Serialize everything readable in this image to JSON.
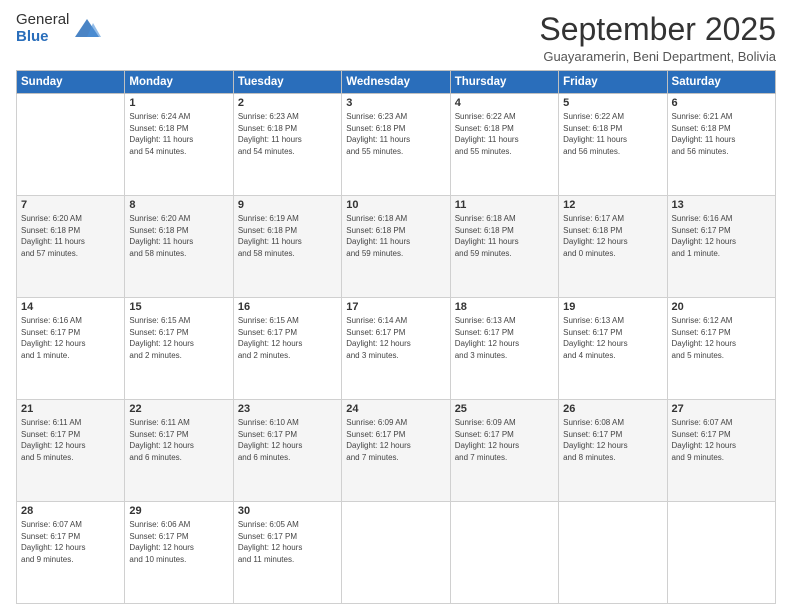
{
  "logo": {
    "general": "General",
    "blue": "Blue"
  },
  "header": {
    "month": "September 2025",
    "location": "Guayaramerin, Beni Department, Bolivia"
  },
  "weekdays": [
    "Sunday",
    "Monday",
    "Tuesday",
    "Wednesday",
    "Thursday",
    "Friday",
    "Saturday"
  ],
  "weeks": [
    [
      {
        "day": "",
        "info": ""
      },
      {
        "day": "1",
        "info": "Sunrise: 6:24 AM\nSunset: 6:18 PM\nDaylight: 11 hours\nand 54 minutes."
      },
      {
        "day": "2",
        "info": "Sunrise: 6:23 AM\nSunset: 6:18 PM\nDaylight: 11 hours\nand 54 minutes."
      },
      {
        "day": "3",
        "info": "Sunrise: 6:23 AM\nSunset: 6:18 PM\nDaylight: 11 hours\nand 55 minutes."
      },
      {
        "day": "4",
        "info": "Sunrise: 6:22 AM\nSunset: 6:18 PM\nDaylight: 11 hours\nand 55 minutes."
      },
      {
        "day": "5",
        "info": "Sunrise: 6:22 AM\nSunset: 6:18 PM\nDaylight: 11 hours\nand 56 minutes."
      },
      {
        "day": "6",
        "info": "Sunrise: 6:21 AM\nSunset: 6:18 PM\nDaylight: 11 hours\nand 56 minutes."
      }
    ],
    [
      {
        "day": "7",
        "info": "Sunrise: 6:20 AM\nSunset: 6:18 PM\nDaylight: 11 hours\nand 57 minutes."
      },
      {
        "day": "8",
        "info": "Sunrise: 6:20 AM\nSunset: 6:18 PM\nDaylight: 11 hours\nand 58 minutes."
      },
      {
        "day": "9",
        "info": "Sunrise: 6:19 AM\nSunset: 6:18 PM\nDaylight: 11 hours\nand 58 minutes."
      },
      {
        "day": "10",
        "info": "Sunrise: 6:18 AM\nSunset: 6:18 PM\nDaylight: 11 hours\nand 59 minutes."
      },
      {
        "day": "11",
        "info": "Sunrise: 6:18 AM\nSunset: 6:18 PM\nDaylight: 11 hours\nand 59 minutes."
      },
      {
        "day": "12",
        "info": "Sunrise: 6:17 AM\nSunset: 6:18 PM\nDaylight: 12 hours\nand 0 minutes."
      },
      {
        "day": "13",
        "info": "Sunrise: 6:16 AM\nSunset: 6:17 PM\nDaylight: 12 hours\nand 1 minute."
      }
    ],
    [
      {
        "day": "14",
        "info": "Sunrise: 6:16 AM\nSunset: 6:17 PM\nDaylight: 12 hours\nand 1 minute."
      },
      {
        "day": "15",
        "info": "Sunrise: 6:15 AM\nSunset: 6:17 PM\nDaylight: 12 hours\nand 2 minutes."
      },
      {
        "day": "16",
        "info": "Sunrise: 6:15 AM\nSunset: 6:17 PM\nDaylight: 12 hours\nand 2 minutes."
      },
      {
        "day": "17",
        "info": "Sunrise: 6:14 AM\nSunset: 6:17 PM\nDaylight: 12 hours\nand 3 minutes."
      },
      {
        "day": "18",
        "info": "Sunrise: 6:13 AM\nSunset: 6:17 PM\nDaylight: 12 hours\nand 3 minutes."
      },
      {
        "day": "19",
        "info": "Sunrise: 6:13 AM\nSunset: 6:17 PM\nDaylight: 12 hours\nand 4 minutes."
      },
      {
        "day": "20",
        "info": "Sunrise: 6:12 AM\nSunset: 6:17 PM\nDaylight: 12 hours\nand 5 minutes."
      }
    ],
    [
      {
        "day": "21",
        "info": "Sunrise: 6:11 AM\nSunset: 6:17 PM\nDaylight: 12 hours\nand 5 minutes."
      },
      {
        "day": "22",
        "info": "Sunrise: 6:11 AM\nSunset: 6:17 PM\nDaylight: 12 hours\nand 6 minutes."
      },
      {
        "day": "23",
        "info": "Sunrise: 6:10 AM\nSunset: 6:17 PM\nDaylight: 12 hours\nand 6 minutes."
      },
      {
        "day": "24",
        "info": "Sunrise: 6:09 AM\nSunset: 6:17 PM\nDaylight: 12 hours\nand 7 minutes."
      },
      {
        "day": "25",
        "info": "Sunrise: 6:09 AM\nSunset: 6:17 PM\nDaylight: 12 hours\nand 7 minutes."
      },
      {
        "day": "26",
        "info": "Sunrise: 6:08 AM\nSunset: 6:17 PM\nDaylight: 12 hours\nand 8 minutes."
      },
      {
        "day": "27",
        "info": "Sunrise: 6:07 AM\nSunset: 6:17 PM\nDaylight: 12 hours\nand 9 minutes."
      }
    ],
    [
      {
        "day": "28",
        "info": "Sunrise: 6:07 AM\nSunset: 6:17 PM\nDaylight: 12 hours\nand 9 minutes."
      },
      {
        "day": "29",
        "info": "Sunrise: 6:06 AM\nSunset: 6:17 PM\nDaylight: 12 hours\nand 10 minutes."
      },
      {
        "day": "30",
        "info": "Sunrise: 6:05 AM\nSunset: 6:17 PM\nDaylight: 12 hours\nand 11 minutes."
      },
      {
        "day": "",
        "info": ""
      },
      {
        "day": "",
        "info": ""
      },
      {
        "day": "",
        "info": ""
      },
      {
        "day": "",
        "info": ""
      }
    ]
  ]
}
